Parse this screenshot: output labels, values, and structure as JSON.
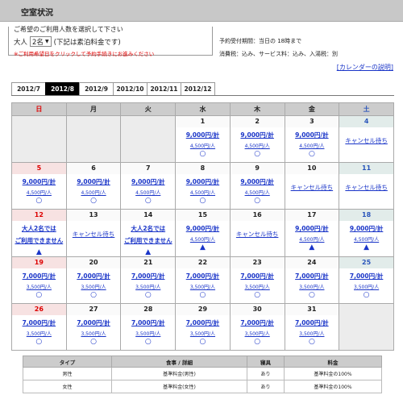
{
  "header": {
    "title": "空室状況"
  },
  "guest": {
    "legend": "ご希望のご利用人数を選択して下さい",
    "label": "大人",
    "count": "2名",
    "hint": "(下記は素泊料金です)",
    "note": "※ご利用希望日をクリックして予約手続きにお進みください"
  },
  "reserve_info": {
    "line1": "予約受付期間：当日の 18時まで",
    "line2": "消費税：込み、サービス料：込み、入湯税：別"
  },
  "calendar_help": "[カレンダーの説明]",
  "tabs": [
    "2012/7",
    "2012/8",
    "2012/9",
    "2012/10",
    "2012/11",
    "2012/12"
  ],
  "active_tab": 1,
  "weekdays": [
    "日",
    "月",
    "火",
    "水",
    "木",
    "金",
    "土"
  ],
  "weeks": [
    [
      null,
      null,
      null,
      {
        "day": "1",
        "price": "9,000円/計",
        "per": "4,500円/人",
        "mark": "○"
      },
      {
        "day": "2",
        "price": "9,000円/計",
        "per": "4,500円/人",
        "mark": "○"
      },
      {
        "day": "3",
        "price": "9,000円/計",
        "per": "4,500円/人",
        "mark": "○"
      },
      {
        "day": "4",
        "status": "キャンセル待ち"
      }
    ],
    [
      {
        "day": "5",
        "price": "9,000円/計",
        "per": "4,500円/人",
        "mark": "○"
      },
      {
        "day": "6",
        "price": "9,000円/計",
        "per": "4,500円/人",
        "mark": "○"
      },
      {
        "day": "7",
        "price": "9,000円/計",
        "per": "4,500円/人",
        "mark": "○"
      },
      {
        "day": "8",
        "price": "9,000円/計",
        "per": "4,500円/人",
        "mark": "○"
      },
      {
        "day": "9",
        "price": "9,000円/計",
        "per": "4,500円/人",
        "mark": "○"
      },
      {
        "day": "10",
        "status": "キャンセル待ち"
      },
      {
        "day": "11",
        "status": "キャンセル待ち"
      }
    ],
    [
      {
        "day": "12",
        "limit1": "大人2名では",
        "limit2": "ご利用できません",
        "mark": "▲"
      },
      {
        "day": "13",
        "status": "キャンセル待ち"
      },
      {
        "day": "14",
        "limit1": "大人2名では",
        "limit2": "ご利用できません",
        "mark": "▲"
      },
      {
        "day": "15",
        "price": "9,000円/計",
        "per": "4,500円/人",
        "mark": "▲"
      },
      {
        "day": "16",
        "status": "キャンセル待ち"
      },
      {
        "day": "17",
        "price": "9,000円/計",
        "per": "4,500円/人",
        "mark": "▲"
      },
      {
        "day": "18",
        "price": "9,000円/計",
        "per": "4,500円/人",
        "mark": "▲"
      }
    ],
    [
      {
        "day": "19",
        "price": "7,000円/計",
        "per": "3,500円/人",
        "mark": "○"
      },
      {
        "day": "20",
        "price": "7,000円/計",
        "per": "3,500円/人",
        "mark": "○"
      },
      {
        "day": "21",
        "price": "7,000円/計",
        "per": "3,500円/人",
        "mark": "○"
      },
      {
        "day": "22",
        "price": "7,000円/計",
        "per": "3,500円/人",
        "mark": "○"
      },
      {
        "day": "23",
        "price": "7,000円/計",
        "per": "3,500円/人",
        "mark": "○"
      },
      {
        "day": "24",
        "price": "7,000円/計",
        "per": "3,500円/人",
        "mark": "○"
      },
      {
        "day": "25",
        "price": "7,000円/計",
        "per": "3,500円/人",
        "mark": "○"
      }
    ],
    [
      {
        "day": "26",
        "price": "7,000円/計",
        "per": "3,500円/人",
        "mark": "○"
      },
      {
        "day": "27",
        "price": "7,000円/計",
        "per": "3,500円/人",
        "mark": "○"
      },
      {
        "day": "28",
        "price": "7,000円/計",
        "per": "3,500円/人",
        "mark": "○"
      },
      {
        "day": "29",
        "price": "7,000円/計",
        "per": "3,500円/人",
        "mark": "○"
      },
      {
        "day": "30",
        "price": "7,000円/計",
        "per": "3,500円/人",
        "mark": "○"
      },
      {
        "day": "31",
        "price": "7,000円/計",
        "per": "3,500円/人",
        "mark": "○"
      },
      null
    ]
  ],
  "type_table": {
    "headers": [
      "タイプ",
      "食事 / 詳細",
      "寝具",
      "料金"
    ],
    "rows": [
      [
        "男性",
        "基準料金(男性)",
        "あり",
        "基準料金の100%"
      ],
      [
        "女性",
        "基準料金(女性)",
        "あり",
        "基準料金の100%"
      ]
    ]
  },
  "colors": {
    "link": "#1a35c8",
    "sunday": "#dd0000",
    "saturday": "#2a55bb",
    "header_bg": "#c8c8c8"
  }
}
